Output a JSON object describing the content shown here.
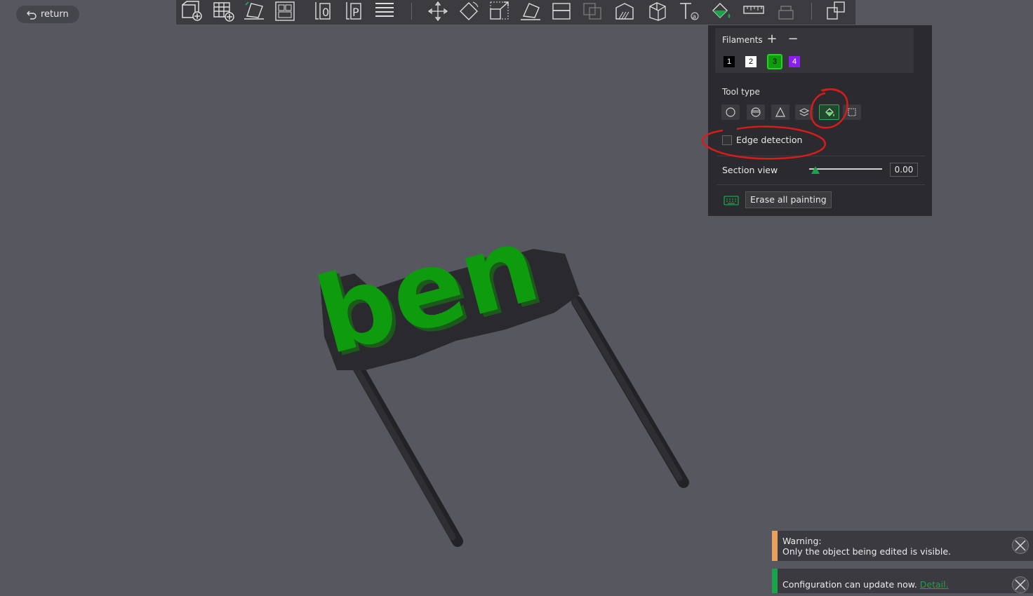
{
  "topbar": {
    "return_label": "return"
  },
  "toolbar": {
    "tools": [
      "add-object-icon",
      "add-plate-icon",
      "auto-orient-icon",
      "arrange-icon",
      "split-objects-icon",
      "split-parts-icon",
      "layers-icon",
      "move-icon",
      "rotate-icon",
      "scale-icon",
      "lay-on-face-icon",
      "cut-icon",
      "boolean-icon",
      "support-paint-icon",
      "seam-paint-icon",
      "text-icon",
      "color-paint-icon",
      "measure-icon",
      "assembly-icon",
      "explode-icon"
    ]
  },
  "paint_panel": {
    "filaments_label": "Filaments",
    "add_symbol": "+",
    "remove_symbol": "−",
    "filaments": [
      {
        "number": "1",
        "color": "#000000"
      },
      {
        "number": "2",
        "color": "#ffffff"
      },
      {
        "number": "3",
        "color": "#0e9b0e",
        "selected": true
      },
      {
        "number": "4",
        "color": "#8b1ff0"
      }
    ],
    "tool_type_label": "Tool type",
    "tool_types": [
      "circle-icon",
      "sphere-icon",
      "triangle-icon",
      "height-range-icon",
      "fill-bucket-icon",
      "gap-fill-icon"
    ],
    "selected_tool": "fill-bucket-icon",
    "edge_detection_label": "Edge detection",
    "edge_detection_checked": false,
    "section_view_label": "Section view",
    "section_view_value": "0.00",
    "section_view_fraction": 0.0,
    "erase_label": "Erase all painting"
  },
  "model": {
    "text": "ben",
    "color": "#0e9b0e"
  },
  "notifications": [
    {
      "type": "warning",
      "title": "Warning:",
      "message": "Only the object being edited is visible."
    },
    {
      "type": "info",
      "message": "Configuration can update now.",
      "link": "Detail."
    }
  ]
}
